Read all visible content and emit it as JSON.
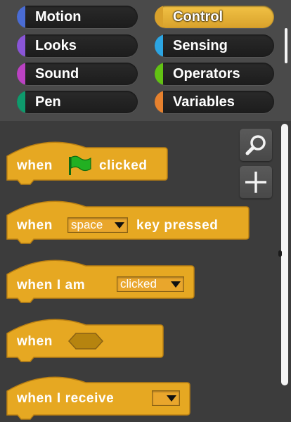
{
  "categories": [
    {
      "id": "motion",
      "label": "Motion",
      "color": "#4a6cd4",
      "selected": false
    },
    {
      "id": "control",
      "label": "Control",
      "color": "#d9a12b",
      "selected": true
    },
    {
      "id": "looks",
      "label": "Looks",
      "color": "#8a55d7",
      "selected": false
    },
    {
      "id": "sensing",
      "label": "Sensing",
      "color": "#2ca5e2",
      "selected": false
    },
    {
      "id": "sound",
      "label": "Sound",
      "color": "#bb42c3",
      "selected": false
    },
    {
      "id": "operators",
      "label": "Operators",
      "color": "#62c213",
      "selected": false
    },
    {
      "id": "pen",
      "label": "Pen",
      "color": "#0e9a6c",
      "selected": false
    },
    {
      "id": "variables",
      "label": "Variables",
      "color": "#e6812e",
      "selected": false
    }
  ],
  "palette": {
    "block_color": "#e6a822",
    "block_outline": "#b97f12",
    "icons": {
      "search": "search-icon",
      "add": "plus-icon",
      "flag": "green-flag-icon"
    },
    "blocks": {
      "flag": {
        "when": "when",
        "clicked": "clicked"
      },
      "key": {
        "when": "when",
        "dropdown": "space",
        "rest": "key pressed"
      },
      "sprite": {
        "text": "when I am",
        "dropdown": "clicked"
      },
      "condition": {
        "when": "when"
      },
      "receive": {
        "text": "when I receive",
        "dropdown": ""
      }
    }
  }
}
